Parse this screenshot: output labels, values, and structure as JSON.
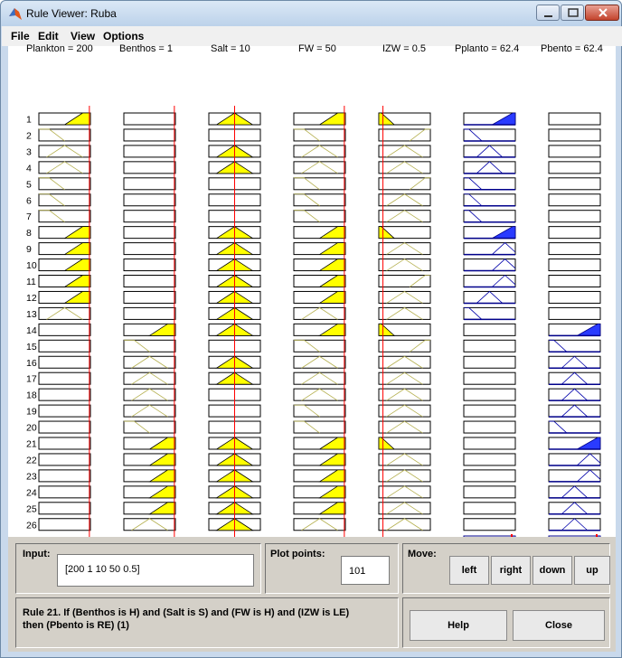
{
  "window": {
    "title": "Rule Viewer: Ruba"
  },
  "menu": {
    "file": "File",
    "edit": "Edit",
    "view": "View",
    "options": "Options"
  },
  "headers": {
    "plankton": "Plankton = 200",
    "benthos": "Benthos = 1",
    "salt": "Salt = 10",
    "fw": "FW = 50",
    "izw": "IZW = 0.5",
    "pplanto": "Pplanto = 62.4",
    "pbento": "Pbento = 62.4"
  },
  "rule_numbers": [
    "1",
    "2",
    "3",
    "4",
    "5",
    "6",
    "7",
    "8",
    "9",
    "10",
    "11",
    "12",
    "13",
    "14",
    "15",
    "16",
    "17",
    "18",
    "19",
    "20",
    "21",
    "22",
    "23",
    "24",
    "25",
    "26"
  ],
  "rules": {
    "plankton": [
      "H",
      "L",
      "M",
      "M",
      "L",
      "L",
      "L",
      "H",
      "H",
      "H",
      "H",
      "H",
      "M",
      "-",
      "-",
      "-",
      "-",
      "-",
      "-",
      "-",
      "-",
      "-",
      "-",
      "-",
      "-",
      "-"
    ],
    "benthos": [
      "-",
      "-",
      "-",
      "-",
      "-",
      "-",
      "-",
      "-",
      "-",
      "-",
      "-",
      "-",
      "-",
      "H",
      "L",
      "M",
      "M",
      "M",
      "M",
      "L",
      "H",
      "H",
      "H",
      "H",
      "H",
      "M"
    ],
    "salt": [
      "S",
      "-",
      "S",
      "S",
      "-",
      "-",
      "-",
      "S",
      "S",
      "S",
      "S",
      "S",
      "S",
      "S",
      "-",
      "S",
      "S",
      "-",
      "-",
      "-",
      "S",
      "S",
      "S",
      "S",
      "S",
      "S"
    ],
    "fw": [
      "H",
      "L",
      "M",
      "M",
      "L",
      "L",
      "L",
      "H",
      "H",
      "H",
      "H",
      "H",
      "M",
      "H",
      "L",
      "M",
      "M",
      "M",
      "L",
      "L",
      "H",
      "H",
      "H",
      "H",
      "H",
      "M"
    ],
    "izw": [
      "LE",
      "HE",
      "M",
      "M",
      "HE",
      "M",
      "M",
      "LE",
      "M",
      "M",
      "HE",
      "M",
      "M",
      "LE",
      "HE",
      "M",
      "M",
      "M",
      "M",
      "M",
      "LE",
      "M",
      "M",
      "M",
      "M",
      "M"
    ],
    "pplanto": [
      "RE",
      "LO",
      "MD",
      "MD",
      "LO",
      "LO",
      "LO",
      "RE",
      "HI",
      "HI",
      "HI",
      "MD",
      "LO",
      "-",
      "-",
      "-",
      "-",
      "-",
      "-",
      "-",
      "-",
      "-",
      "-",
      "-",
      "-",
      "-"
    ],
    "pbento": [
      "-",
      "-",
      "-",
      "-",
      "-",
      "-",
      "-",
      "-",
      "-",
      "-",
      "-",
      "-",
      "-",
      "RE",
      "LO",
      "MD",
      "MD",
      "MD",
      "MD",
      "LO",
      "RE",
      "HI",
      "HI",
      "MD",
      "MD",
      "MD"
    ]
  },
  "inputs_marker": {
    "plankton": 0.98,
    "benthos": 0.98,
    "salt": 0.5,
    "fw": 0.98,
    "izw": 0.08
  },
  "colors": {
    "input_fill": "#ffff00",
    "output_fill": "#2a3bff",
    "marker": "#ff0000"
  },
  "controls": {
    "input_label": "Input:",
    "input_value": "[200 1 10 50 0.5]",
    "plot_points_label": "Plot points:",
    "plot_points_value": "101",
    "move_label": "Move:",
    "left": "left",
    "right": "right",
    "down": "down",
    "up": "up",
    "help": "Help",
    "close": "Close"
  },
  "status": {
    "line1": "Rule 21. If (Benthos is H) and (Salt is S) and (FW is H) and (IZW is LE)",
    "line2": "then (Pbento is RE) (1)"
  }
}
